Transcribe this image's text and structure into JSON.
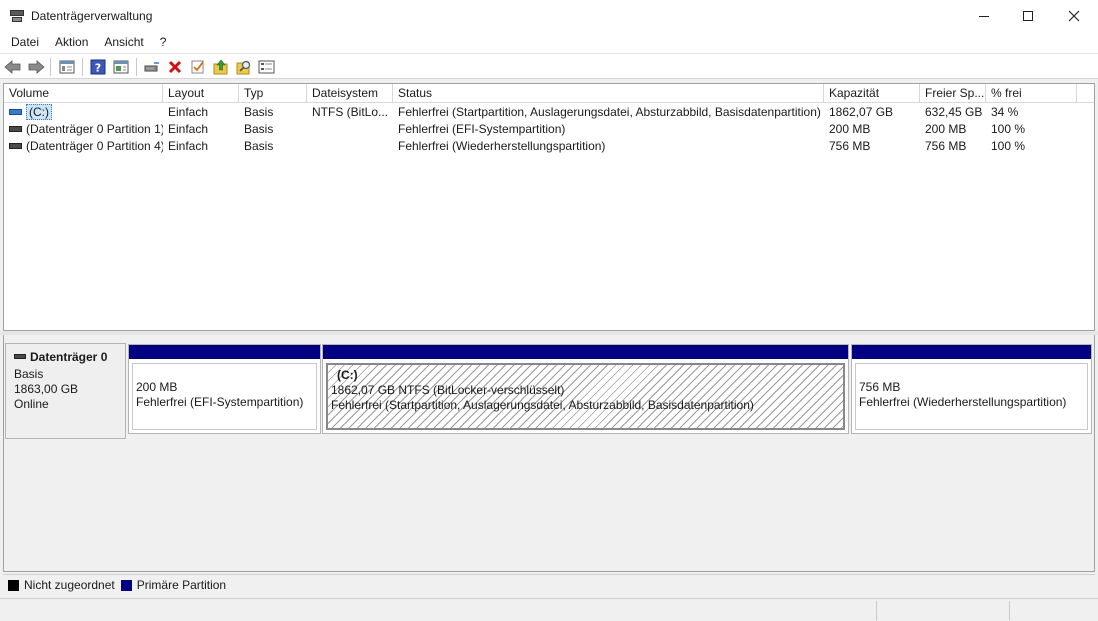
{
  "window": {
    "title": "Datenträgerverwaltung",
    "controls": {
      "minimize": "minimize-icon",
      "maximize": "maximize-icon",
      "close": "close-icon"
    }
  },
  "menu": [
    "Datei",
    "Aktion",
    "Ansicht",
    "?"
  ],
  "toolbar": {
    "icons": [
      "back-icon",
      "forward-icon",
      "show-hide-console-tree-icon",
      "help-icon",
      "properties-icon",
      "connect-disk-icon",
      "delete-icon",
      "check-icon",
      "up-folder-icon",
      "search-icon",
      "disk-list-icon"
    ]
  },
  "volume_list": {
    "columns": [
      "Volume",
      "Layout",
      "Typ",
      "Dateisystem",
      "Status",
      "Kapazität",
      "Freier Sp...",
      "% frei"
    ],
    "rows": [
      [
        "(C:)",
        "Einfach",
        "Basis",
        "NTFS (BitLo...",
        "Fehlerfrei (Startpartition, Auslagerungsdatei, Absturzabbild, Basisdatenpartition)",
        "1862,07 GB",
        "632,45 GB",
        "34 %"
      ],
      [
        "(Datenträger 0 Partition 1)",
        "Einfach",
        "Basis",
        "",
        "Fehlerfrei (EFI-Systempartition)",
        "200 MB",
        "200 MB",
        "100 %"
      ],
      [
        "(Datenträger 0 Partition 4)",
        "Einfach",
        "Basis",
        "",
        "Fehlerfrei (Wiederherstellungspartition)",
        "756 MB",
        "756 MB",
        "100 %"
      ]
    ]
  },
  "disk": {
    "name": "Datenträger 0",
    "type": "Basis",
    "size": "1863,00 GB",
    "state": "Online",
    "partitions": [
      {
        "label": "",
        "line1": "200 MB",
        "line2": "Fehlerfrei (EFI-Systempartition)"
      },
      {
        "label": "(C:)",
        "line1": "1862,07 GB NTFS (BitLocker-verschlüsselt)",
        "line2": "Fehlerfrei (Startpartition, Auslagerungsdatei, Absturzabbild, Basisdatenpartition)"
      },
      {
        "label": "",
        "line1": "756 MB",
        "line2": "Fehlerfrei (Wiederherstellungspartition)"
      }
    ]
  },
  "legend": [
    {
      "label": "Nicht zugeordnet",
      "color": "#000000"
    },
    {
      "label": "Primäre Partition",
      "color": "#000080"
    }
  ],
  "colors": {
    "partition_bar": "#000080",
    "selection": "#cce4f7"
  }
}
